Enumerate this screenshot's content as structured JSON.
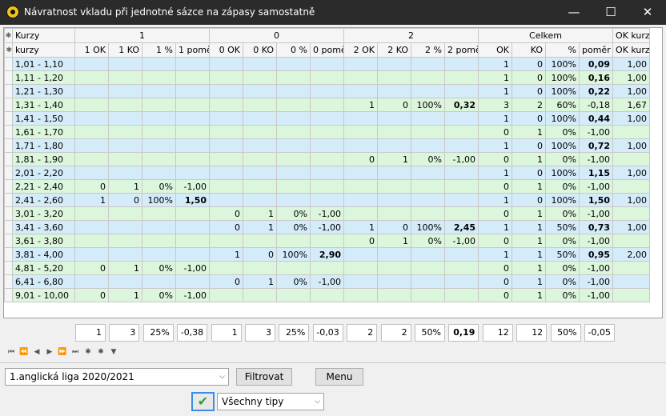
{
  "window": {
    "title": "Návratnost vkladu při jednotné sázce na zápasy samostatně"
  },
  "header1": {
    "kurzy": "Kurzy",
    "g1": "1",
    "g0": "0",
    "g2": "2",
    "celkem": "Celkem",
    "okkurz": "OK kurz"
  },
  "header2": [
    "kurzy",
    "1 OK",
    "1 KO",
    "1 %",
    "1 pomě",
    "0 OK",
    "0 KO",
    "0 %",
    "0 pomě",
    "2 OK",
    "2 KO",
    "2 %",
    "2 pomě",
    "OK",
    "KO",
    "%",
    "poměr",
    "OK kurz"
  ],
  "rows": [
    {
      "c": [
        "1,01 - 1,10",
        "",
        "",
        "",
        "",
        "",
        "",
        "",
        "",
        "",
        "",
        "",
        "",
        "1",
        "0",
        "100%",
        "0,09",
        "1,00"
      ]
    },
    {
      "c": [
        "1,11 - 1,20",
        "",
        "",
        "",
        "",
        "",
        "",
        "",
        "",
        "",
        "",
        "",
        "",
        "1",
        "0",
        "100%",
        "0,16",
        "1,00"
      ]
    },
    {
      "c": [
        "1,21 - 1,30",
        "",
        "",
        "",
        "",
        "",
        "",
        "",
        "",
        "",
        "",
        "",
        "",
        "1",
        "0",
        "100%",
        "0,22",
        "1,00"
      ]
    },
    {
      "c": [
        "1,31 - 1,40",
        "",
        "",
        "",
        "",
        "",
        "",
        "",
        "",
        "1",
        "0",
        "100%",
        "0,32",
        "3",
        "2",
        "60%",
        "-0,18",
        "1,67"
      ]
    },
    {
      "c": [
        "1,41 - 1,50",
        "",
        "",
        "",
        "",
        "",
        "",
        "",
        "",
        "",
        "",
        "",
        "",
        "1",
        "0",
        "100%",
        "0,44",
        "1,00"
      ]
    },
    {
      "c": [
        "1,61 - 1,70",
        "",
        "",
        "",
        "",
        "",
        "",
        "",
        "",
        "",
        "",
        "",
        "",
        "0",
        "1",
        "0%",
        "-1,00",
        ""
      ]
    },
    {
      "c": [
        "1,71 - 1,80",
        "",
        "",
        "",
        "",
        "",
        "",
        "",
        "",
        "",
        "",
        "",
        "",
        "1",
        "0",
        "100%",
        "0,72",
        "1,00"
      ]
    },
    {
      "c": [
        "1,81 - 1,90",
        "",
        "",
        "",
        "",
        "",
        "",
        "",
        "",
        "0",
        "1",
        "0%",
        "-1,00",
        "0",
        "1",
        "0%",
        "-1,00",
        ""
      ]
    },
    {
      "c": [
        "2,01 - 2,20",
        "",
        "",
        "",
        "",
        "",
        "",
        "",
        "",
        "",
        "",
        "",
        "",
        "1",
        "0",
        "100%",
        "1,15",
        "1,00"
      ]
    },
    {
      "c": [
        "2,21 - 2,40",
        "0",
        "1",
        "0%",
        "-1,00",
        "",
        "",
        "",
        "",
        "",
        "",
        "",
        "",
        "0",
        "1",
        "0%",
        "-1,00",
        ""
      ]
    },
    {
      "c": [
        "2,41 - 2,60",
        "1",
        "0",
        "100%",
        "1,50",
        "",
        "",
        "",
        "",
        "",
        "",
        "",
        "",
        "1",
        "0",
        "100%",
        "1,50",
        "1,00"
      ]
    },
    {
      "c": [
        "3,01 - 3,20",
        "",
        "",
        "",
        "",
        "0",
        "1",
        "0%",
        "-1,00",
        "",
        "",
        "",
        "",
        "0",
        "1",
        "0%",
        "-1,00",
        ""
      ]
    },
    {
      "c": [
        "3,41 - 3,60",
        "",
        "",
        "",
        "",
        "0",
        "1",
        "0%",
        "-1,00",
        "1",
        "0",
        "100%",
        "2,45",
        "1",
        "1",
        "50%",
        "0,73",
        "1,00"
      ]
    },
    {
      "c": [
        "3,61 - 3,80",
        "",
        "",
        "",
        "",
        "",
        "",
        "",
        "",
        "0",
        "1",
        "0%",
        "-1,00",
        "0",
        "1",
        "0%",
        "-1,00",
        ""
      ]
    },
    {
      "c": [
        "3,81 - 4,00",
        "",
        "",
        "",
        "",
        "1",
        "0",
        "100%",
        "2,90",
        "",
        "",
        "",
        "",
        "1",
        "1",
        "50%",
        "0,95",
        "2,00"
      ]
    },
    {
      "c": [
        "4,81 - 5,20",
        "0",
        "1",
        "0%",
        "-1,00",
        "",
        "",
        "",
        "",
        "",
        "",
        "",
        "",
        "0",
        "1",
        "0%",
        "-1,00",
        ""
      ]
    },
    {
      "c": [
        "6,41 - 6,80",
        "",
        "",
        "",
        "",
        "0",
        "1",
        "0%",
        "-1,00",
        "",
        "",
        "",
        "",
        "0",
        "1",
        "0%",
        "-1,00",
        ""
      ]
    },
    {
      "c": [
        "9,01 - 10,00",
        "0",
        "1",
        "0%",
        "-1,00",
        "",
        "",
        "",
        "",
        "",
        "",
        "",
        "",
        "0",
        "1",
        "0%",
        "-1,00",
        ""
      ]
    }
  ],
  "totals": [
    "1",
    "3",
    "25%",
    "-0,38",
    "1",
    "3",
    "25%",
    "-0,03",
    "2",
    "2",
    "50%",
    "0,19",
    "12",
    "12",
    "50%",
    "-0,05"
  ],
  "league_select": {
    "value": "1.anglická liga 2020/2021"
  },
  "buttons": {
    "filter": "Filtrovat",
    "menu": "Menu"
  },
  "tips_select": {
    "value": "Všechny tipy"
  }
}
